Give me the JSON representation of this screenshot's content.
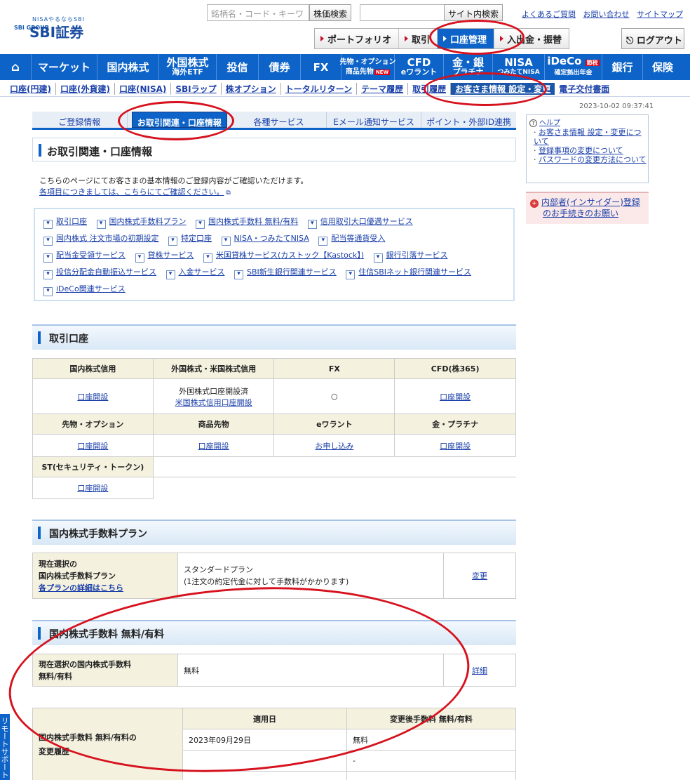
{
  "header": {
    "logo_tagline": "NISAやるならSBI",
    "logo_group": "SBI GROUP",
    "logo_name": "SBI証券",
    "stock_search_placeholder": "銘柄名・コード・キーワ",
    "stock_search_button": "株価検索",
    "site_search_button": "サイト内検索",
    "top_links": [
      "よくあるご質問",
      "お問い合わせ",
      "サイトマップ"
    ]
  },
  "subnav": {
    "items": [
      "ポートフォリオ",
      "取引",
      "口座管理",
      "入出金・振替"
    ],
    "active": "口座管理",
    "logout": "ログアウト"
  },
  "global_nav": {
    "items": [
      {
        "label": "マーケット"
      },
      {
        "label": "国内株式"
      },
      {
        "label": "外国株式",
        "sub": "海外ETF"
      },
      {
        "label": "投信"
      },
      {
        "label": "債券"
      },
      {
        "label": "FX"
      },
      {
        "label": "先物・オプション",
        "sub": "商品先物",
        "badge": "NEW"
      },
      {
        "label": "CFD",
        "sub": "eワラント"
      },
      {
        "label": "金・銀",
        "sub": "プラチナ"
      },
      {
        "label": "NISA",
        "sub": "つみたてNISA"
      },
      {
        "label": "iDeCo",
        "sub": "確定拠出年金",
        "badge": "節税"
      },
      {
        "label": "銀行"
      },
      {
        "label": "保険"
      }
    ]
  },
  "secondary_nav": {
    "items": [
      "口座(円建)",
      "口座(外貨建)",
      "口座(NISA)",
      "SBIラップ",
      "株オプション",
      "トータルリターン",
      "テーマ履歴",
      "取引履歴",
      "お客さま情報 設定・変更",
      "電子交付書面"
    ],
    "selected": "お客さま情報 設定・変更"
  },
  "timestamp": "2023-10-02 09:37:41",
  "tabs": {
    "items": [
      "ご登録情報",
      "お取引関連・口座情報",
      "各種サービス",
      "Eメール通知サービス",
      "ポイント・外部ID連携"
    ],
    "active": "お取引関連・口座情報"
  },
  "page_title": "お取引関連・口座情報",
  "intro": {
    "line1": "こちらのページにてお客さまの基本情報のご登録内容がご確認いただけます。",
    "line2": "各項目につきましては、こちらにてご確認ください。"
  },
  "anchor_links": [
    [
      "取引口座",
      "国内株式手数料プラン",
      "国内株式手数料 無料/有料",
      "信用取引大口優遇サービス"
    ],
    [
      "国内株式 注文市場の初期設定",
      "特定口座",
      "NISA・つみたてNISA",
      "配当等通貨受入"
    ],
    [
      "配当金受領サービス",
      "貸株サービス",
      "米国貸株サービス(カストック【Kastock】)",
      "銀行引落サービス"
    ],
    [
      "投信分配金自動振込サービス",
      "入金サービス",
      "SBI新生銀行関連サービス",
      "住信SBIネット銀行関連サービス"
    ],
    [
      "iDeCo関連サービス"
    ]
  ],
  "accounts": {
    "title": "取引口座",
    "row1_headers": [
      "国内株式信用",
      "外国株式・米国株式信用",
      "FX",
      "CFD(株365)"
    ],
    "row1_cells": {
      "domestic_margin": "口座開設",
      "foreign_status": "外国株式口座開設済",
      "foreign_link": "米国株式信用口座開設",
      "fx": "○",
      "cfd": "口座開設"
    },
    "row2_headers": [
      "先物・オプション",
      "商品先物",
      "eワラント",
      "金・プラチナ"
    ],
    "row2_cells": [
      "口座開設",
      "口座開設",
      "お申し込み",
      "口座開設"
    ],
    "row3_header": "ST(セキュリティ・トークン)",
    "row3_cell": "口座開設"
  },
  "fee_plan": {
    "title": "国内株式手数料プラン",
    "label_line1": "現在選択の",
    "label_line2": "国内株式手数料プラン",
    "label_link": "各プランの詳細はこちら",
    "value_line1": "スタンダードプラン",
    "value_line2": "(1注文の約定代金に対して手数料がかかります)",
    "action": "変更"
  },
  "fee_free": {
    "title": "国内株式手数料 無料/有料",
    "label_line1": "現在選択の国内株式手数料",
    "label_line2": "無料/有料",
    "value": "無料",
    "action": "詳細"
  },
  "history": {
    "label_line1": "国内株式手数料 無料/有料の",
    "label_line2": "変更履歴",
    "headers": [
      "適用日",
      "変更後手数料 無料/有料"
    ],
    "rows": [
      [
        "2023年09月29日",
        "無料"
      ],
      [
        "",
        "-"
      ],
      [
        "",
        ""
      ]
    ]
  },
  "help": {
    "title": "ヘルプ",
    "items": [
      "お客さま情報 設定・変更について",
      "登録事項の変更について",
      "パスワードの変更方法について"
    ]
  },
  "insider": {
    "line1": "内部者(インサイダー)登録",
    "line2": "のお手続きのお願い"
  },
  "side_tab": "リモートサポート",
  "colors": {
    "brand_blue": "#0d63c7",
    "annotation_red": "#d6121e",
    "table_header_bg": "#f5f1df"
  }
}
